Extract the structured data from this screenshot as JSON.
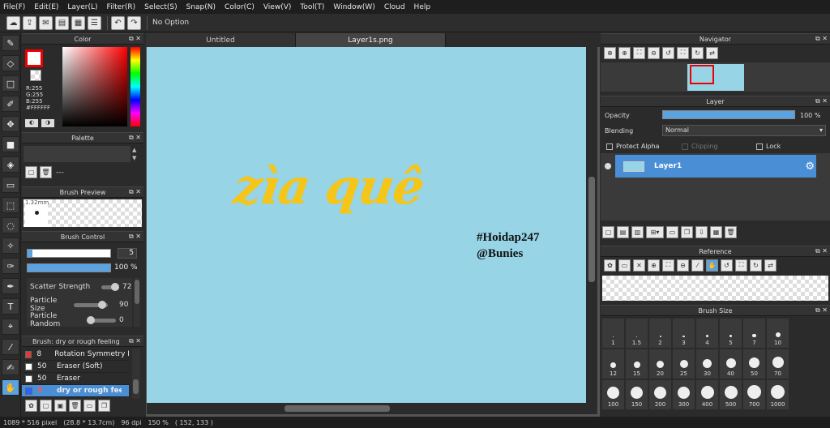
{
  "menu": [
    "File(F)",
    "Edit(E)",
    "Layer(L)",
    "Filter(R)",
    "Select(S)",
    "Snap(N)",
    "Color(C)",
    "View(V)",
    "Tool(T)",
    "Window(W)",
    "Cloud",
    "Help"
  ],
  "toolbar": {
    "option_label": "No Option"
  },
  "color_panel": {
    "title": "Color",
    "r": "R:255",
    "g": "G:255",
    "b": "B:255",
    "hex": "#FFFFFF",
    "accent": "#ff0000"
  },
  "palette_panel": {
    "title": "Palette",
    "value": "---"
  },
  "brush_preview": {
    "title": "Brush Preview",
    "size": "1.32mm"
  },
  "brush_control": {
    "title": "Brush Control",
    "size_value": "5",
    "opacity_value": "100 %",
    "params": [
      {
        "label": "Scatter Strength",
        "value": "72"
      },
      {
        "label": "Particle Size",
        "value": "90"
      },
      {
        "label": "Particle Random",
        "value": "0"
      }
    ]
  },
  "brush_list": {
    "title": "Brush: dry or rough feeling",
    "items": [
      {
        "size": "8",
        "name": "Rotation Symmetry Pe",
        "color": "#e53935"
      },
      {
        "size": "50",
        "name": "Eraser (Soft)",
        "color": "#ffffff"
      },
      {
        "size": "50",
        "name": "Eraser",
        "color": "#ffffff"
      },
      {
        "size": "5",
        "name": "dry or rough feeling",
        "color": "#2962ff"
      }
    ]
  },
  "tabs": [
    {
      "label": "Untitled"
    },
    {
      "label": "Layer1s.png"
    }
  ],
  "canvas": {
    "main_text": "zìa quê",
    "tag1": "#Hoidap247",
    "tag2": "@Bunies",
    "bg": "#96d4e6",
    "text_color": "#f5c518"
  },
  "navigator": {
    "title": "Navigator"
  },
  "layer_panel": {
    "title": "Layer",
    "opacity_label": "Opacity",
    "opacity_value": "100 %",
    "blending_label": "Blending",
    "blending_value": "Normal",
    "protect_alpha": "Protect Alpha",
    "clipping": "Clipping",
    "lock": "Lock",
    "layer_name": "Layer1"
  },
  "reference": {
    "title": "Reference"
  },
  "brush_size": {
    "title": "Brush Size",
    "sizes": [
      "1",
      "1.5",
      "2",
      "3",
      "4",
      "5",
      "7",
      "10",
      "12",
      "15",
      "20",
      "25",
      "30",
      "40",
      "50",
      "70",
      "100",
      "150",
      "200",
      "300",
      "400",
      "500",
      "700",
      "1000"
    ]
  },
  "status": {
    "dims": "1089 * 516 pixel",
    "mm": "(28.8 * 13.7cm)",
    "dpi": "96 dpi",
    "zoom": "150 %",
    "coords": "( 152, 133 )"
  }
}
